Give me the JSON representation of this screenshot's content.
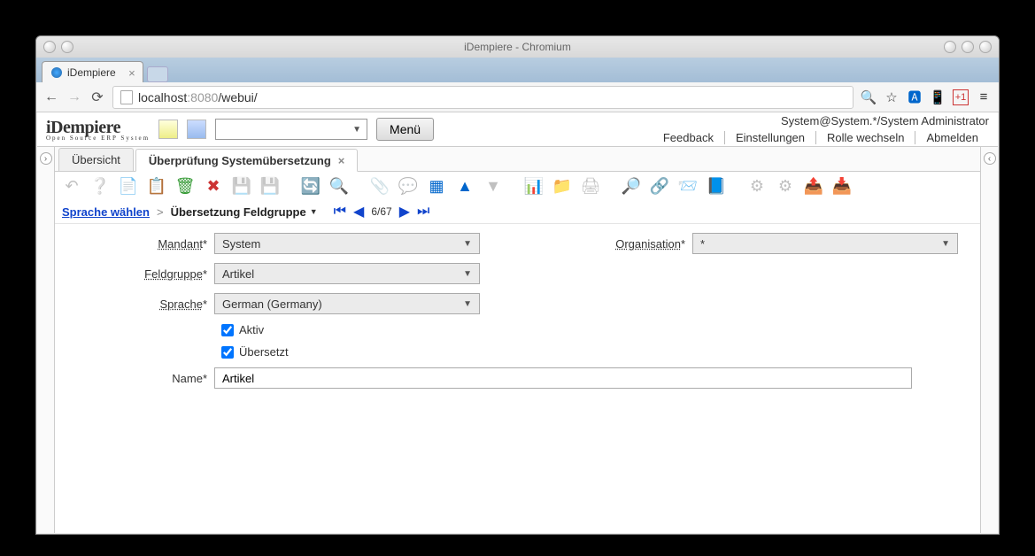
{
  "window_title": "iDempiere - Chromium",
  "browser_tab": "iDempiere",
  "url": {
    "host": "localhost",
    "port": ":8080",
    "path": "/webui/"
  },
  "logo": {
    "main": "iDempiere",
    "sub": "Open Source   ERP System"
  },
  "menu_button": "Menü",
  "user_context": "System@System.*/System Administrator",
  "links": {
    "feedback": "Feedback",
    "settings": "Einstellungen",
    "role": "Rolle wechseln",
    "logout": "Abmelden"
  },
  "tabs": {
    "overview": "Übersicht",
    "active": "Überprüfung Systemübersetzung"
  },
  "breadcrumb": {
    "lang": "Sprache wählen",
    "sep": ">",
    "current": "Übersetzung Feldgruppe"
  },
  "record_nav": {
    "count": "6/67"
  },
  "form": {
    "mandant": {
      "label": "Mandant",
      "value": "System"
    },
    "organisation": {
      "label": "Organisation",
      "value": "*"
    },
    "feldgruppe": {
      "label": "Feldgruppe",
      "value": "Artikel"
    },
    "sprache": {
      "label": "Sprache",
      "value": "German (Germany)"
    },
    "aktiv": {
      "label": "Aktiv",
      "checked": true
    },
    "uebersetzt": {
      "label": "Übersetzt",
      "checked": true
    },
    "name": {
      "label": "Name",
      "value": "Artikel"
    }
  }
}
